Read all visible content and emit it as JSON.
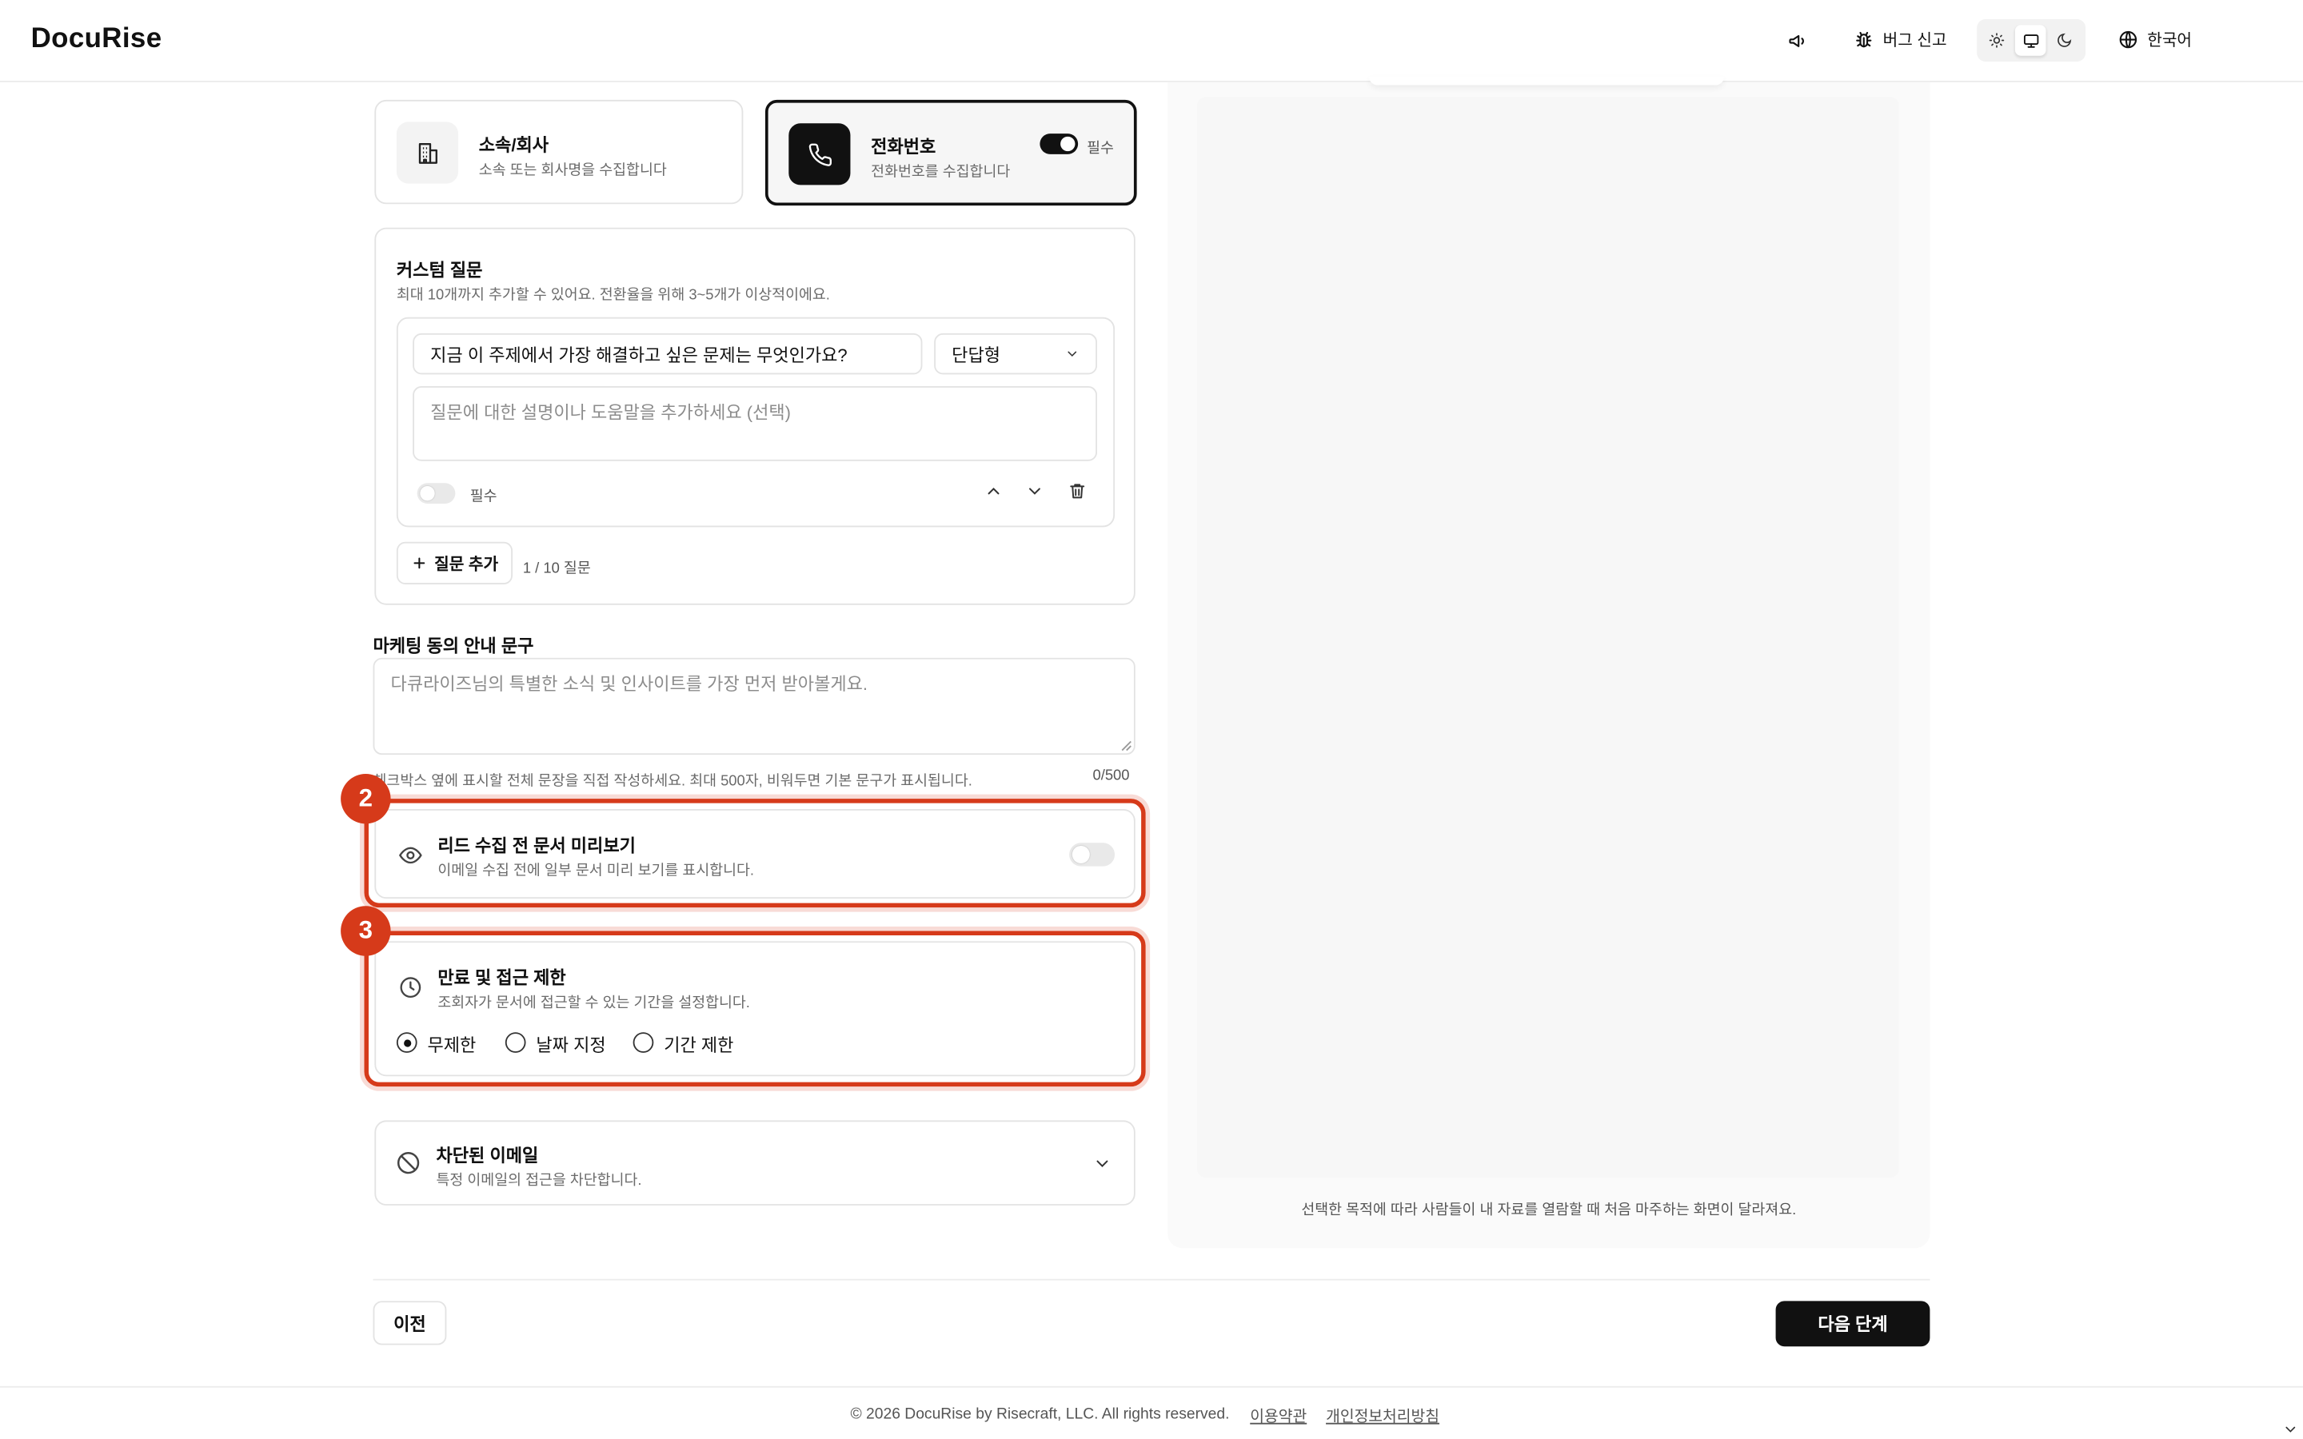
{
  "header": {
    "logo": "DocuRise",
    "bug_report": "버그 신고",
    "language": "한국어"
  },
  "fields": {
    "company": {
      "title": "소속/회사",
      "desc": "소속 또는 회사명을 수집합니다"
    },
    "phone": {
      "title": "전화번호",
      "desc": "전화번호를 수집합니다",
      "required_label": "필수",
      "required": true
    }
  },
  "custom_questions": {
    "title": "커스텀 질문",
    "desc": "최대 10개까지 추가할 수 있어요. 전환율을 위해 3~5개가 이상적이에요.",
    "question_value": "지금 이 주제에서 가장 해결하고 싶은 문제는 무엇인가요?",
    "type_selected": "단답형",
    "help_placeholder": "질문에 대한 설명이나 도움말을 추가하세요 (선택)",
    "required_label": "필수",
    "add_button": "질문 추가",
    "count": "1 / 10 질문"
  },
  "marketing": {
    "label": "마케팅 동의 안내 문구",
    "placeholder": "다큐라이즈님의 특별한 소식 및 인사이트를 가장 먼저 받아볼게요.",
    "help": "체크박스 옆에 표시할 전체 문장을 직접 작성하세요. 최대 500자, 비워두면 기본 문구가 표시됩니다.",
    "counter": "0/500"
  },
  "preview_option": {
    "badge": "2",
    "title": "리드 수집 전 문서 미리보기",
    "desc": "이메일 수집 전에 일부 문서 미리 보기를 표시합니다."
  },
  "expiry": {
    "badge": "3",
    "title": "만료 및 접근 제한",
    "desc": "조회자가 문서에 접근할 수 있는 기간을 설정합니다.",
    "options": [
      "무제한",
      "날짜 지정",
      "기간 제한"
    ],
    "selected": "무제한"
  },
  "blocked": {
    "title": "차단된 이메일",
    "desc": "특정 이메일의 접근을 차단합니다."
  },
  "preview_caption": "선택한 목적에 따라 사람들이 내 자료를 열람할 때 처음 마주하는 화면이 달라져요.",
  "nav": {
    "prev": "이전",
    "next": "다음 단계"
  },
  "footer": {
    "copyright": "© 2026 DocuRise by Risecraft, LLC. All rights reserved.",
    "terms": "이용약관",
    "privacy": "개인정보처리방침"
  },
  "colors": {
    "accent": "#111111",
    "highlight": "#d63a1a"
  }
}
